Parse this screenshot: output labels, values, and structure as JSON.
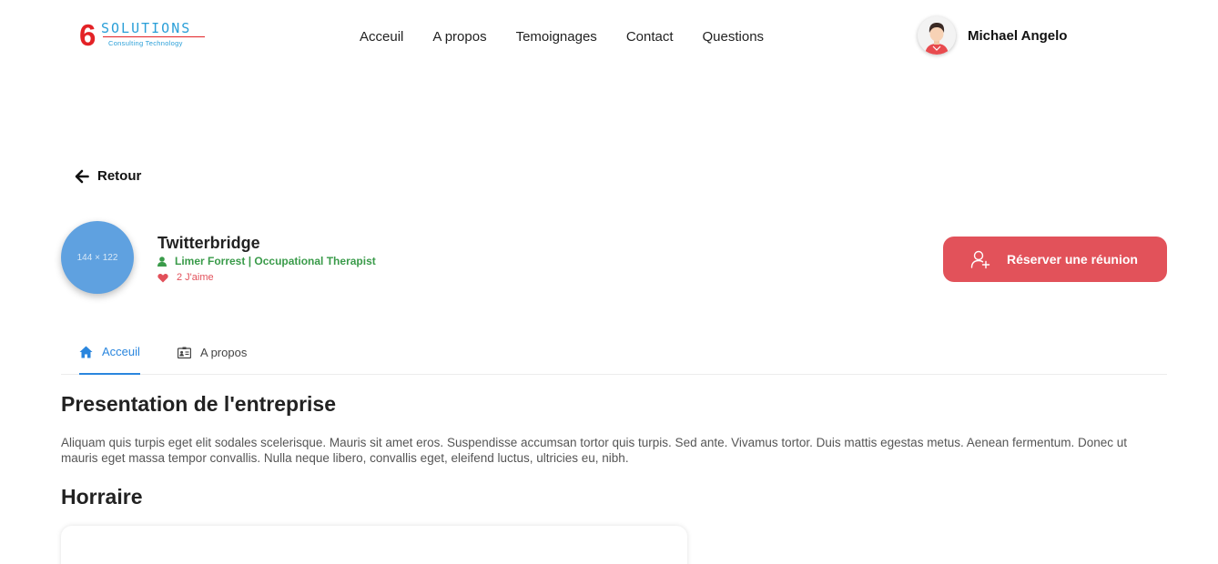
{
  "logo": {
    "number": "6",
    "word": "SOLUTIONS",
    "tagline": "Consulting Technology"
  },
  "nav": [
    "Acceuil",
    "A propos",
    "Temoignages",
    "Contact",
    "Questions"
  ],
  "user": {
    "name": "Michael Angelo"
  },
  "back": {
    "label": "Retour"
  },
  "profile": {
    "image_placeholder": "144 × 122",
    "company": "Twitterbridge",
    "owner": "Limer Forrest | Occupational Therapist",
    "likes": "2 J'aime"
  },
  "reserve": {
    "label": "Réserver une réunion"
  },
  "tabs": [
    {
      "label": "Acceuil",
      "active": true,
      "icon": "home-icon"
    },
    {
      "label": "A propos",
      "active": false,
      "icon": "id-card-icon"
    }
  ],
  "presentation": {
    "title": "Presentation de l'entreprise",
    "text": "Aliquam quis turpis eget elit sodales scelerisque. Mauris sit amet eros. Suspendisse accumsan tortor quis turpis. Sed ante. Vivamus tortor. Duis mattis egestas metus. Aenean fermentum. Donec ut mauris eget massa tempor convallis. Nulla neque libero, convallis eget, eleifend luctus, ultricies eu, nibh."
  },
  "schedule": {
    "title": "Horraire"
  },
  "colors": {
    "accent_blue": "#2a86de",
    "reserve_red": "#e2525a",
    "owner_green": "#3a9b4a",
    "likes_red": "#e2505a"
  }
}
